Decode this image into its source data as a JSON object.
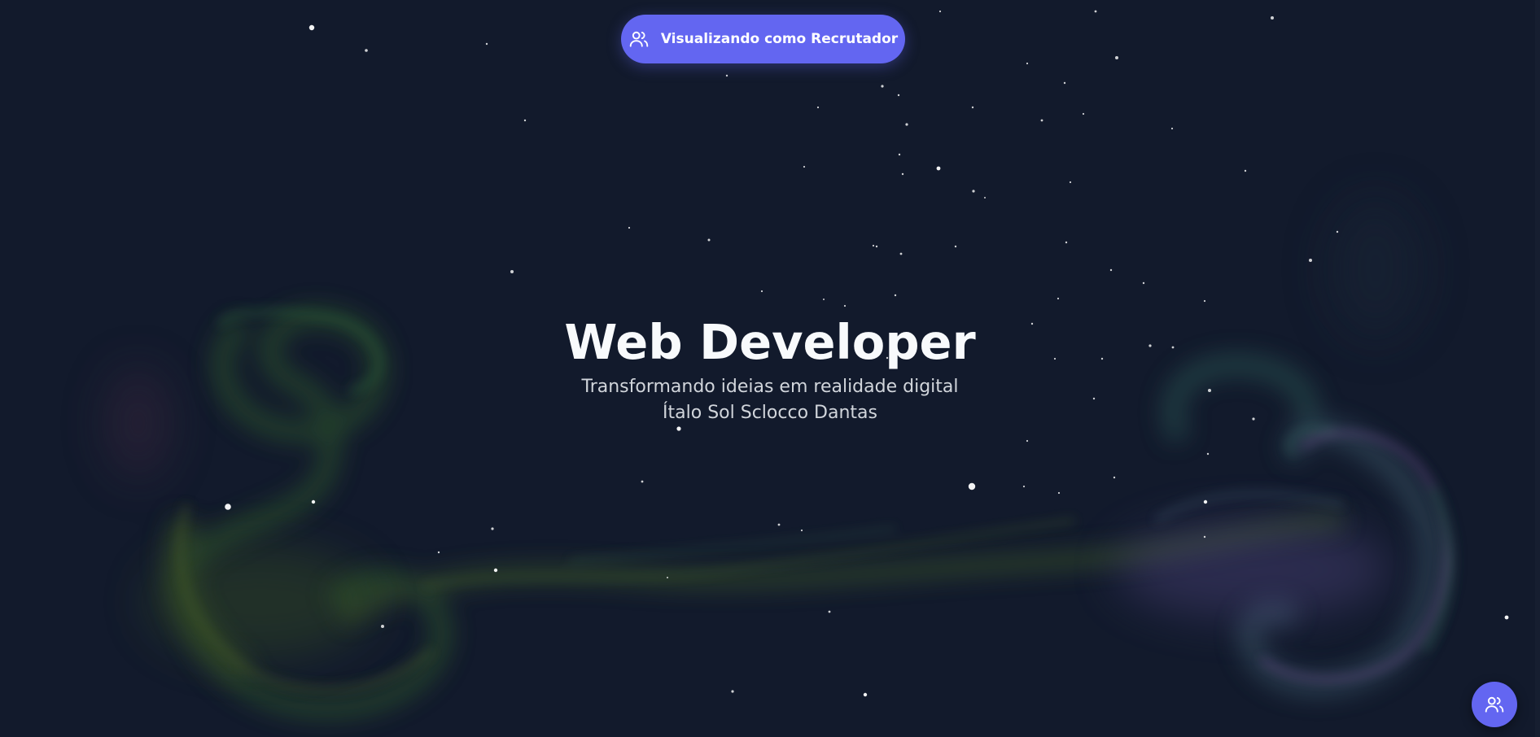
{
  "recruiter_toggle": {
    "label": "Visualizando como Recrutador",
    "icon": "users-icon"
  },
  "hero": {
    "title": "Web Developer",
    "subtitle": "Transformando ideias em realidade digital",
    "name": "Ítalo Sol Sclocco Dantas"
  },
  "floating_button": {
    "icon": "users-icon"
  },
  "colors": {
    "background": "#121a2c",
    "accent": "#6366f1",
    "smoke_green": "#3f6b2a",
    "smoke_teal": "#2f6b5a",
    "smoke_purple": "#7a4f9a"
  }
}
